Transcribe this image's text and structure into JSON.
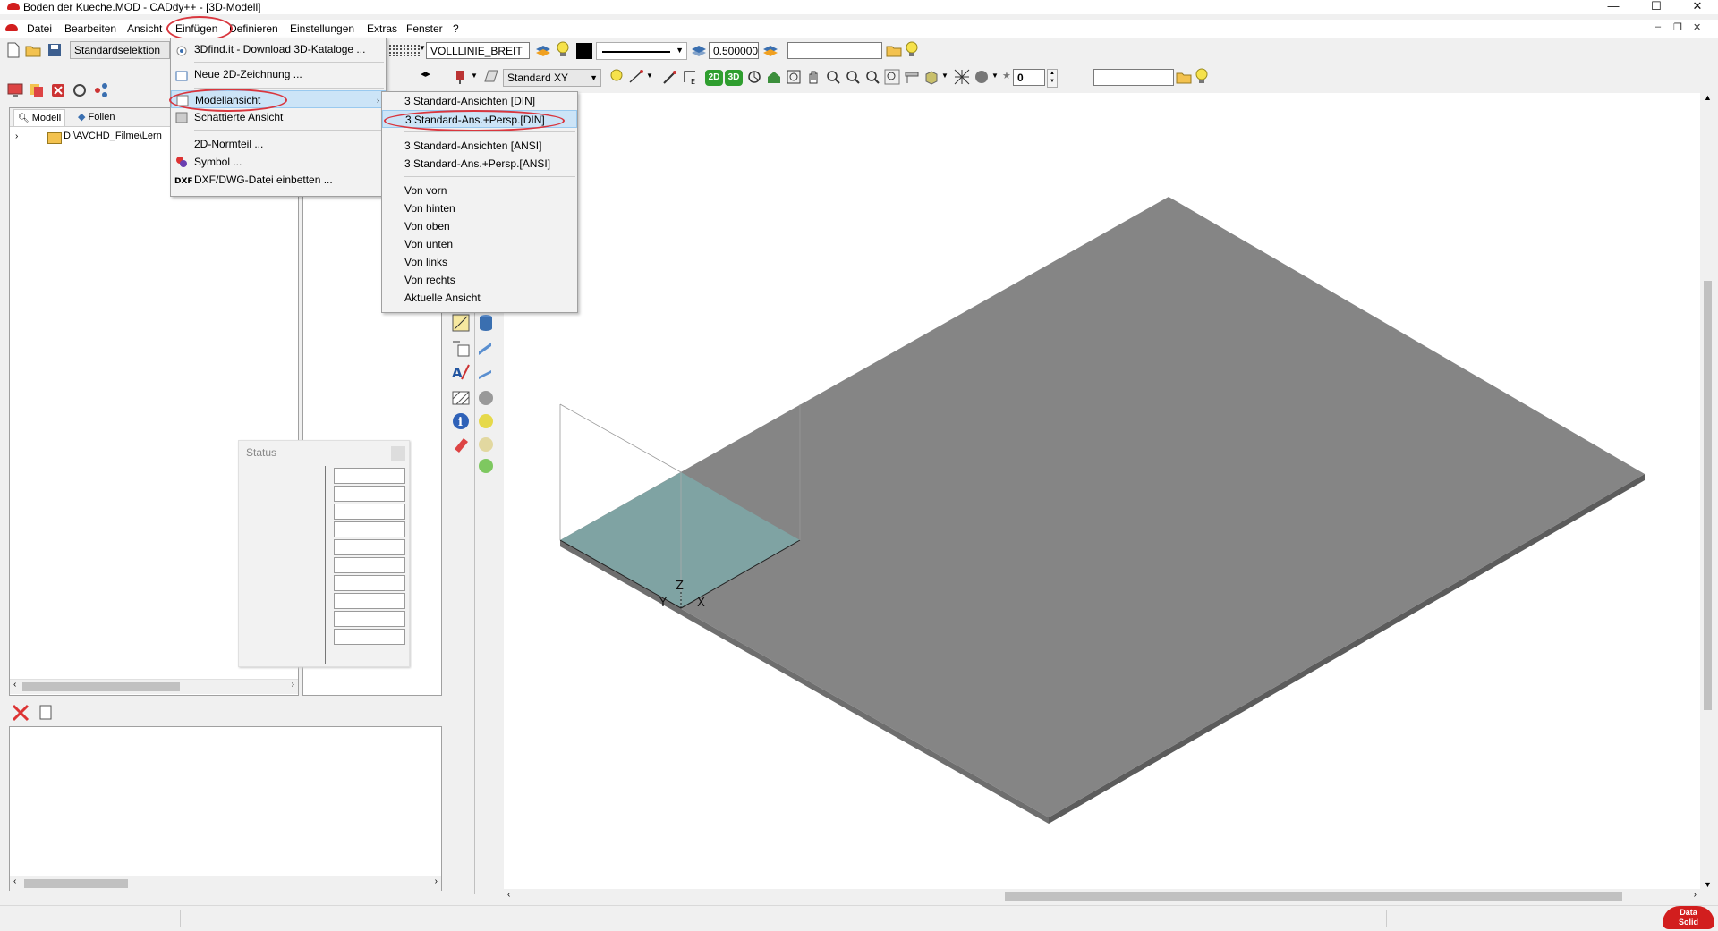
{
  "window": {
    "title": "Boden der Kueche.MOD  -  CADdy++ - [3D-Modell]",
    "controls": {
      "minimize": "—",
      "maximize": "☐",
      "close": "✕"
    },
    "mdi_controls": {
      "minimize": "–",
      "restore": "❐",
      "close": "✕"
    }
  },
  "menubar": {
    "items": [
      "Datei",
      "Bearbeiten",
      "Ansicht",
      "Einfügen",
      "Definieren",
      "Einstellungen",
      "Extras",
      "Fenster",
      "?"
    ]
  },
  "toolbar1": {
    "selection_combo": "Standardselektion",
    "linetype_field": "VOLLLINIE_BREIT",
    "linewidth_field": "0.500000",
    "empty_field": ""
  },
  "toolbar2": {
    "plane_combo": "Standard XY",
    "view_2d": "2D",
    "view_3d": "3D",
    "number_field": "0",
    "empty_field": ""
  },
  "left_panel": {
    "tabs": [
      "Modell",
      "Folien"
    ],
    "tree_path": "D:\\AVCHD_Filme\\Lern"
  },
  "status_box": {
    "title": "Status"
  },
  "einfuegen_menu": {
    "items": [
      "3Dfind.it - Download 3D-Kataloge ...",
      "Neue 2D-Zeichnung ...",
      "Modellansicht",
      "Schattierte Ansicht",
      "2D-Normteil ...",
      "Symbol ...",
      "DXF/DWG-Datei einbetten ..."
    ]
  },
  "modellansicht_submenu": {
    "items": [
      "3 Standard-Ansichten [DIN]",
      "3 Standard-Ans.+Persp.[DIN]",
      "3 Standard-Ansichten [ANSI]",
      "3 Standard-Ans.+Persp.[ANSI]",
      "Von vorn",
      "Von hinten",
      "Von oben",
      "Von unten",
      "Von links",
      "Von rechts",
      "Aktuelle Ansicht"
    ]
  },
  "axes": {
    "x": "X",
    "y": "Y",
    "z": "Z"
  },
  "logo": {
    "line1": "Data",
    "line2": "Solid"
  },
  "colors": {
    "highlight": "#cce4f7",
    "ring": "#d9363e",
    "slab_top": "#858585",
    "slab_side": "#5c5c5c",
    "origin_quad": "#7fa3a3"
  }
}
